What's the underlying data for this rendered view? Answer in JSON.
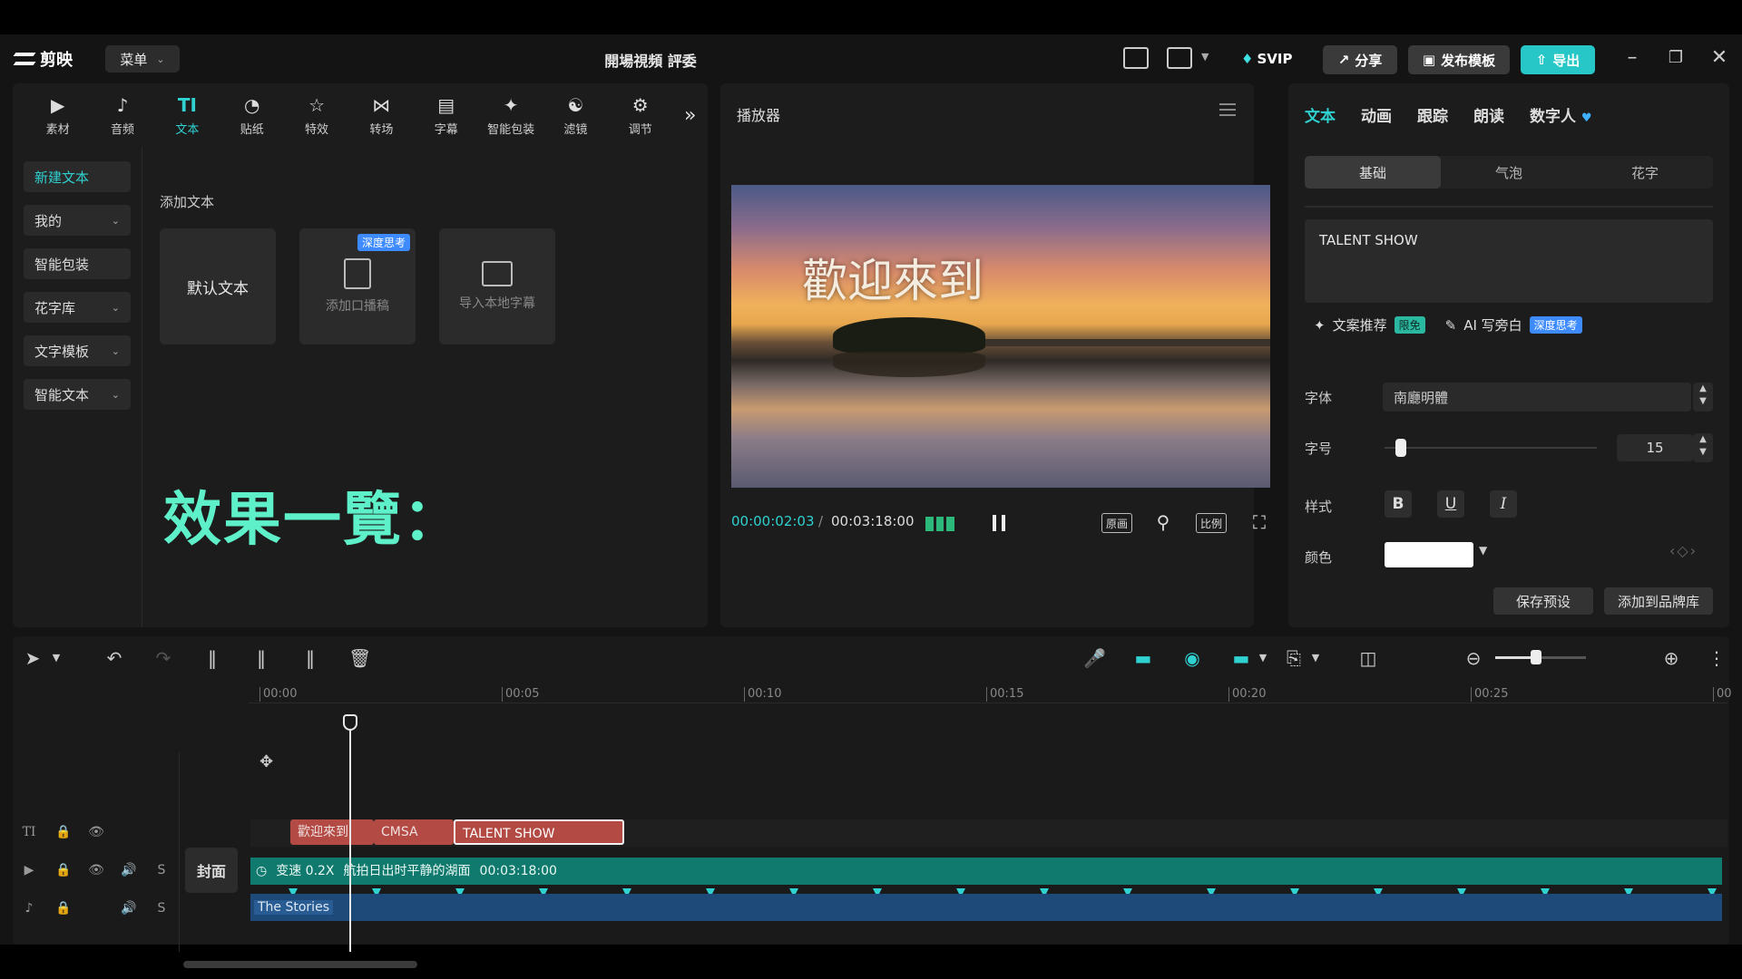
{
  "app": {
    "name": "剪映",
    "menu_label": "菜单",
    "project_title": "開場視頻 評委",
    "svip_label": "SVIP",
    "share_label": "分享",
    "publish_template_label": "发布模板",
    "export_label": "导出"
  },
  "toolbar": {
    "items": [
      {
        "label": "素材",
        "icon": "media-icon"
      },
      {
        "label": "音频",
        "icon": "audio-icon"
      },
      {
        "label": "文本",
        "icon": "text-icon",
        "active": true
      },
      {
        "label": "贴纸",
        "icon": "sticker-icon"
      },
      {
        "label": "特效",
        "icon": "effects-icon"
      },
      {
        "label": "转场",
        "icon": "transition-icon"
      },
      {
        "label": "字幕",
        "icon": "subtitle-icon"
      },
      {
        "label": "智能包装",
        "icon": "smart-pack-icon"
      },
      {
        "label": "滤镜",
        "icon": "filter-icon"
      },
      {
        "label": "调节",
        "icon": "adjust-icon"
      }
    ]
  },
  "sidenav": {
    "items": [
      {
        "label": "新建文本",
        "active": true,
        "dropdown": false
      },
      {
        "label": "我的",
        "dropdown": true
      },
      {
        "label": "智能包装",
        "dropdown": false
      },
      {
        "label": "花字库",
        "dropdown": true
      },
      {
        "label": "文字模板",
        "dropdown": true
      },
      {
        "label": "智能文本",
        "dropdown": true
      }
    ]
  },
  "text_panel": {
    "section_label": "添加文本",
    "cards": [
      {
        "label": "默认文本"
      },
      {
        "label": "添加口播稿",
        "badge": "深度思考"
      },
      {
        "label": "导入本地字幕"
      }
    ],
    "overlay_heading": "效果一覽："
  },
  "player": {
    "title": "播放器",
    "caption": "歡迎來到",
    "current_time": "00:00:02:03",
    "separator": "/",
    "total_time": "00:03:18:00",
    "btn_original": "原画",
    "btn_ratio": "比例"
  },
  "inspector": {
    "tabs": [
      "文本",
      "动画",
      "跟踪",
      "朗读",
      "数字人"
    ],
    "subtabs": [
      "基础",
      "气泡",
      "花字"
    ],
    "text_content": "TALENT SHOW",
    "ai_copy_label": "文案推荐",
    "ai_copy_tag": "限免",
    "ai_write_label": "AI 写旁白",
    "ai_write_tag": "深度思考",
    "font_label": "字体",
    "font_value": "南廳明體",
    "size_label": "字号",
    "size_value": "15",
    "size_slider_fraction": 0.05,
    "style_label": "样式",
    "style_buttons": [
      "B",
      "U",
      "I"
    ],
    "color_label": "颜色",
    "color_value": "#ffffff",
    "save_preset_label": "保存预设",
    "add_brand_label": "添加到品牌库"
  },
  "timeline": {
    "ruler_ticks": [
      "00:00",
      "00:05",
      "00:10",
      "00:15",
      "00:20",
      "00:25",
      "00"
    ],
    "text_clips": [
      "歡迎來到",
      "CMSA",
      "TALENT SHOW"
    ],
    "cover_label": "封面",
    "video_speed": "变速 0.2X",
    "video_name": "航拍日出时平静的湖面",
    "video_duration": "00:03:18:00",
    "audio_name": "The Stories",
    "zoom_fraction": 0.45
  },
  "colors": {
    "accent": "#2fd1d1",
    "heading_green": "#5ef0c8",
    "text_clip": "#b34a44",
    "video_clip": "#117a6e",
    "audio_clip": "#1e4a7a"
  }
}
